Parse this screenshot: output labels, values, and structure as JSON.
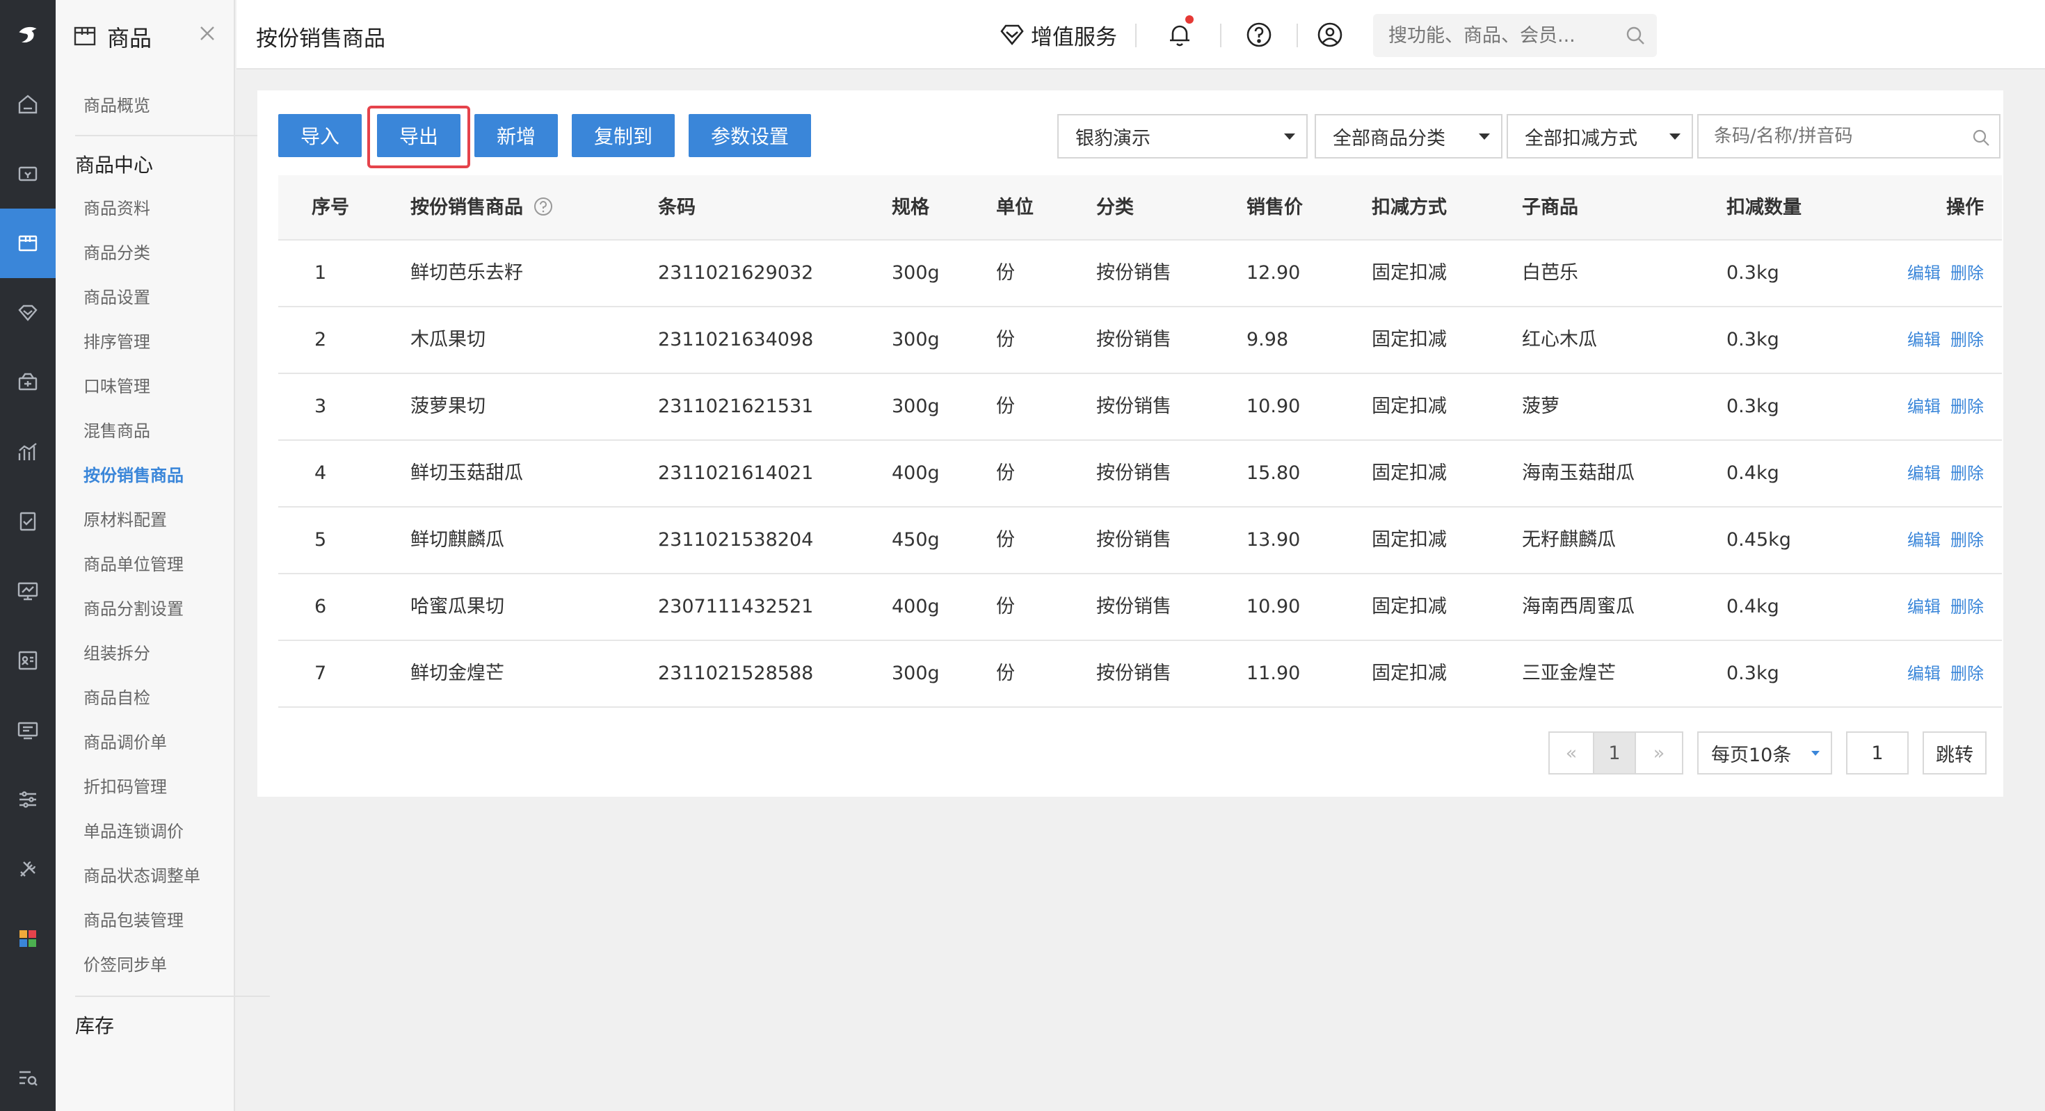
{
  "sidebar_module": {
    "title": "商品"
  },
  "subnav": {
    "overview": "商品概览",
    "group_center": "商品中心",
    "items": [
      "商品资料",
      "商品分类",
      "商品设置",
      "排序管理",
      "口味管理",
      "混售商品",
      "按份销售商品",
      "原材料配置",
      "商品单位管理",
      "商品分割设置",
      "组装拆分",
      "商品自检",
      "商品调价单",
      "折扣码管理",
      "单品连锁调价",
      "商品状态调整单",
      "商品包装管理",
      "价签同步单"
    ],
    "active_index": 6,
    "group_stock": "库存"
  },
  "topbar": {
    "page_title": "按份销售商品",
    "search_placeholder": "搜功能、商品、会员...",
    "value_added": "增值服务"
  },
  "toolbar": {
    "import": "导入",
    "export": "导出",
    "add": "新增",
    "copy_to": "复制到",
    "params": "参数设置"
  },
  "filters": {
    "store": "银豹演示",
    "category": "全部商品分类",
    "deduction": "全部扣减方式",
    "search_placeholder": "条码/名称/拼音码"
  },
  "table": {
    "headers": [
      "序号",
      "按份销售商品",
      "条码",
      "规格",
      "单位",
      "分类",
      "销售价",
      "扣减方式",
      "子商品",
      "扣减数量",
      "操作"
    ],
    "rows": [
      {
        "no": "1",
        "name": "鲜切芭乐去籽",
        "barcode": "2311021629032",
        "spec": "300g",
        "unit": "份",
        "category": "按份销售",
        "price": "12.90",
        "method": "固定扣减",
        "child": "白芭乐",
        "qty": "0.3kg"
      },
      {
        "no": "2",
        "name": "木瓜果切",
        "barcode": "2311021634098",
        "spec": "300g",
        "unit": "份",
        "category": "按份销售",
        "price": "9.98",
        "method": "固定扣减",
        "child": "红心木瓜",
        "qty": "0.3kg"
      },
      {
        "no": "3",
        "name": "菠萝果切",
        "barcode": "2311021621531",
        "spec": "300g",
        "unit": "份",
        "category": "按份销售",
        "price": "10.90",
        "method": "固定扣减",
        "child": "菠萝",
        "qty": "0.3kg"
      },
      {
        "no": "4",
        "name": "鲜切玉菇甜瓜",
        "barcode": "2311021614021",
        "spec": "400g",
        "unit": "份",
        "category": "按份销售",
        "price": "15.80",
        "method": "固定扣减",
        "child": "海南玉菇甜瓜",
        "qty": "0.4kg"
      },
      {
        "no": "5",
        "name": "鲜切麒麟瓜",
        "barcode": "2311021538204",
        "spec": "450g",
        "unit": "份",
        "category": "按份销售",
        "price": "13.90",
        "method": "固定扣减",
        "child": "无籽麒麟瓜",
        "qty": "0.45kg"
      },
      {
        "no": "6",
        "name": "哈蜜瓜果切",
        "barcode": "2307111432521",
        "spec": "400g",
        "unit": "份",
        "category": "按份销售",
        "price": "10.90",
        "method": "固定扣减",
        "child": "海南西周蜜瓜",
        "qty": "0.4kg"
      },
      {
        "no": "7",
        "name": "鲜切金煌芒",
        "barcode": "2311021528588",
        "spec": "300g",
        "unit": "份",
        "category": "按份销售",
        "price": "11.90",
        "method": "固定扣减",
        "child": "三亚金煌芒",
        "qty": "0.3kg"
      }
    ],
    "edit_label": "编辑",
    "delete_label": "删除"
  },
  "pagination": {
    "prev": "«",
    "current": "1",
    "next": "»",
    "page_size": "每页10条",
    "jump_value": "1",
    "jump_label": "跳转"
  },
  "colors": {
    "accent": "#3a86d9",
    "rail": "#2b2e33",
    "highlight": "#e5434b"
  }
}
